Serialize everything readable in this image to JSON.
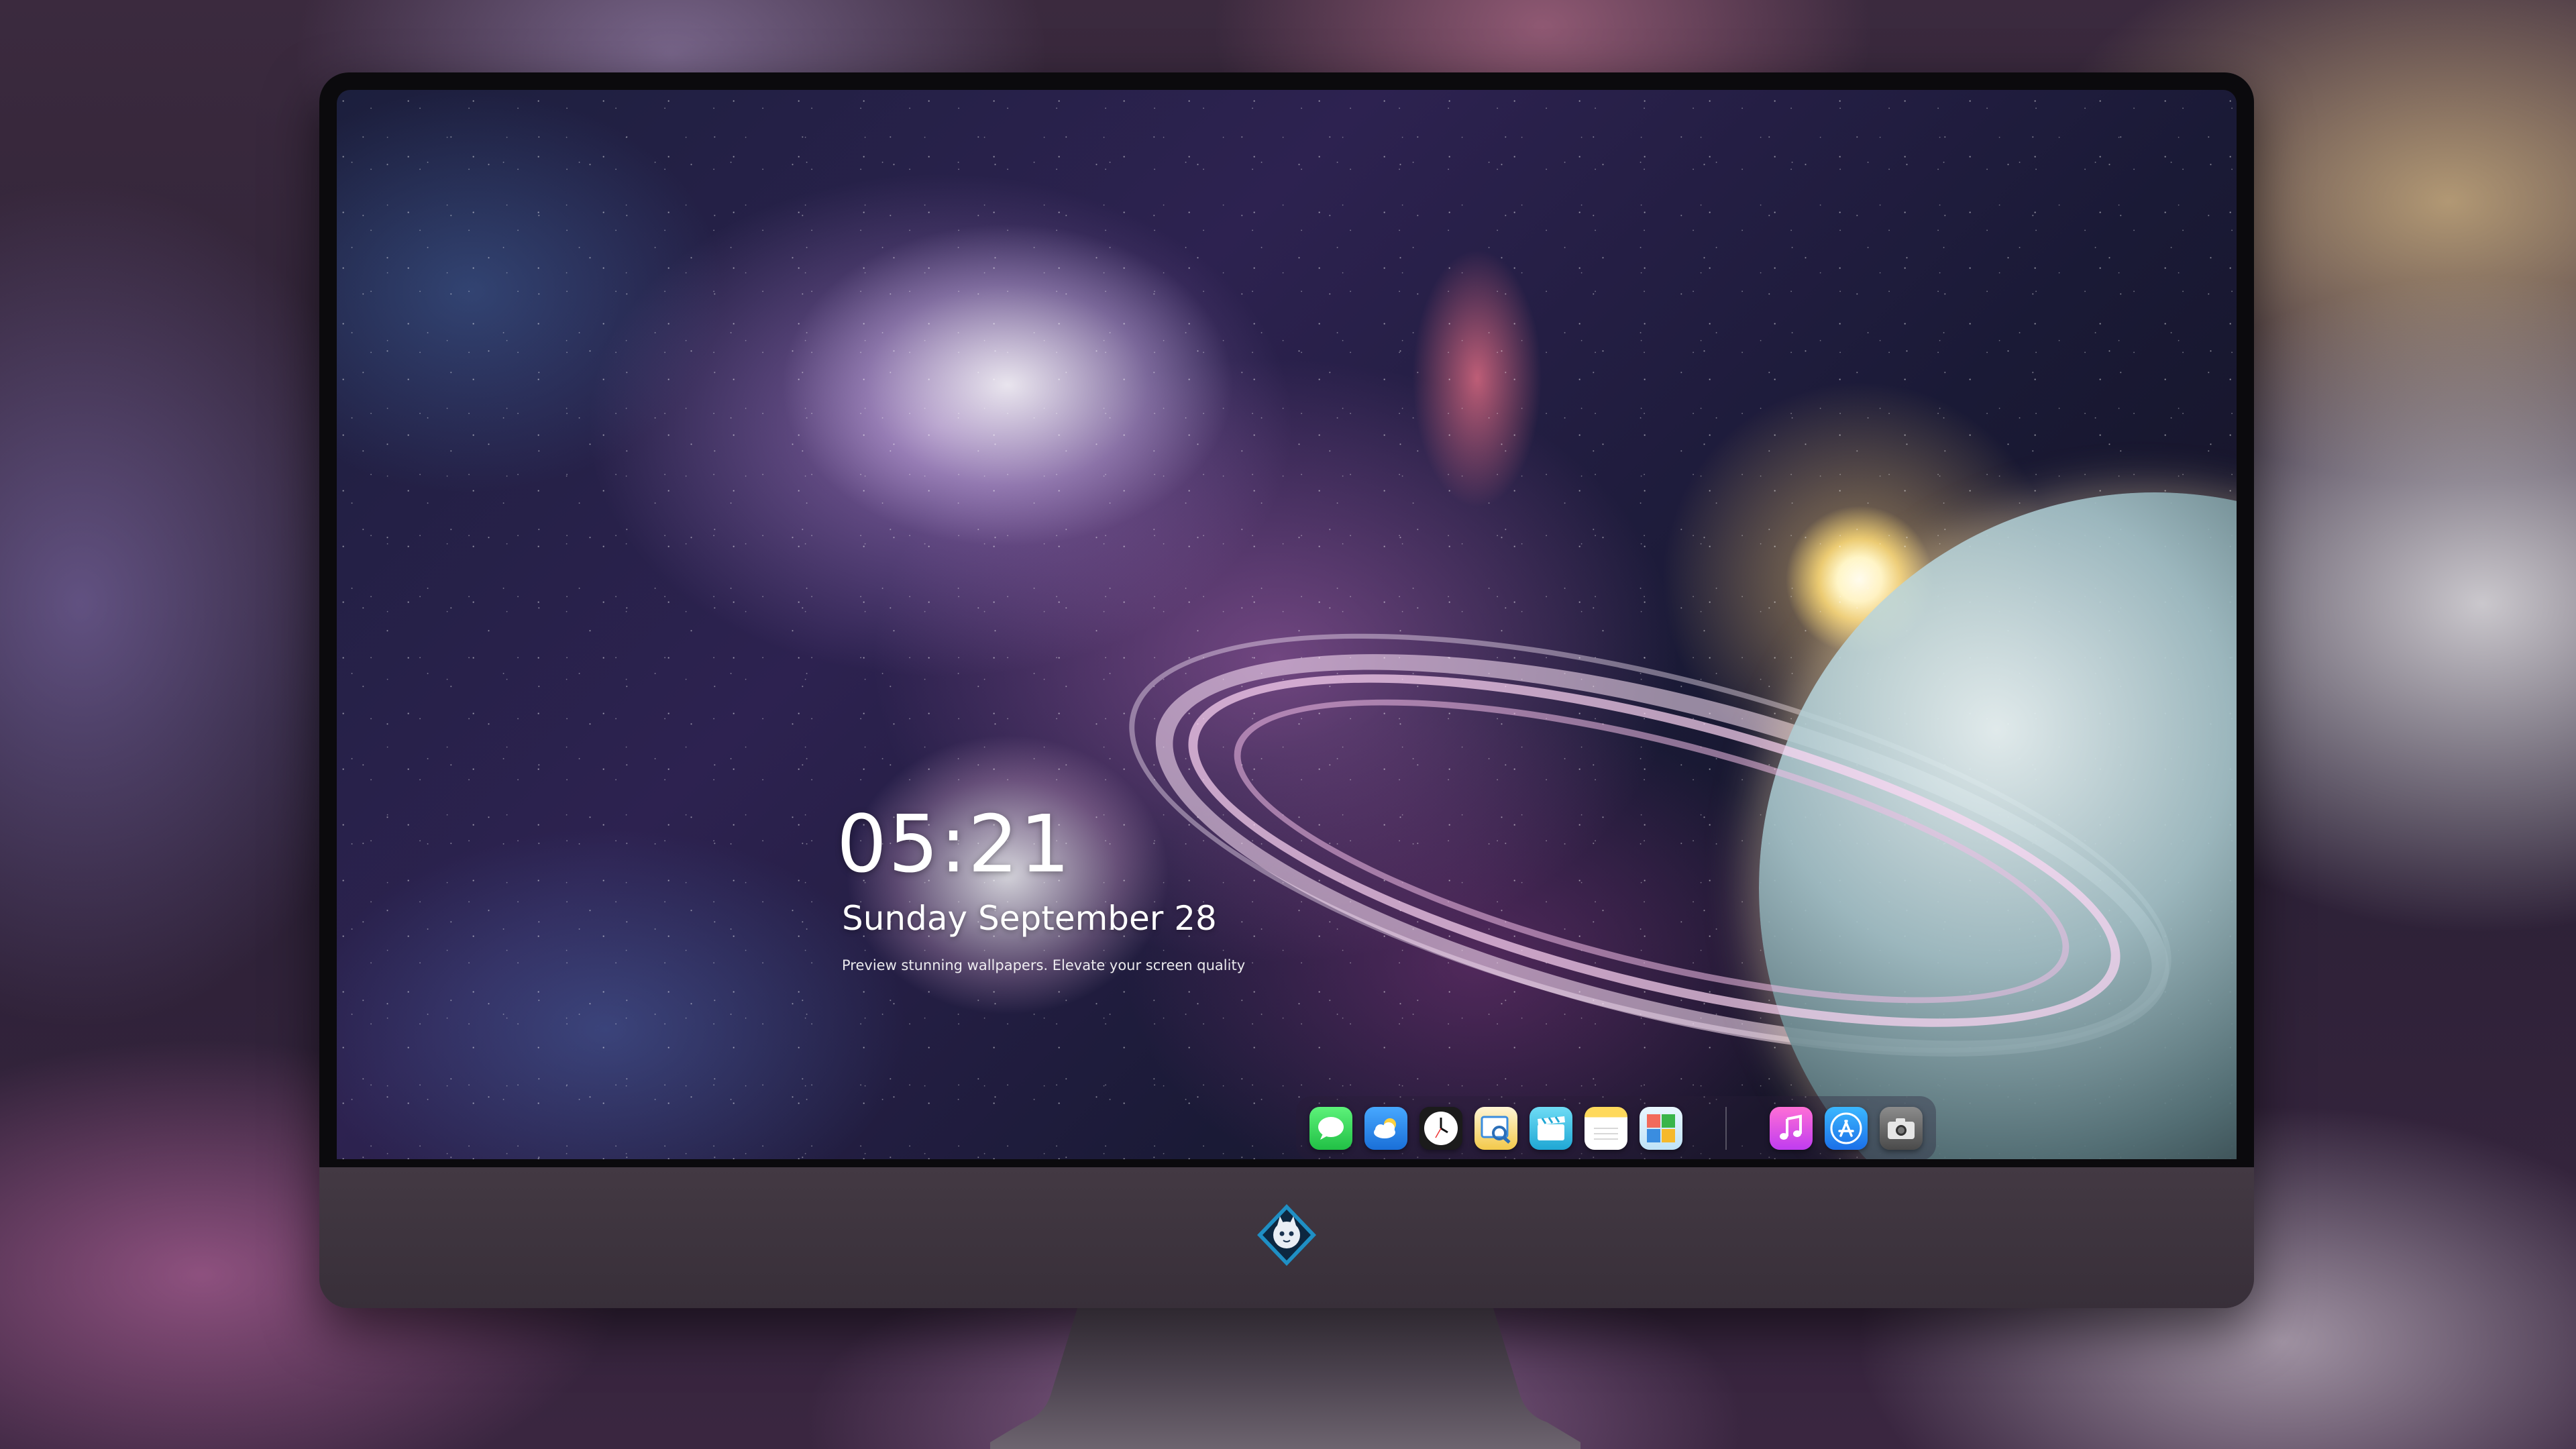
{
  "lockscreen": {
    "time": "05:21",
    "date": "Sunday September  28",
    "tagline": "Preview stunning wallpapers. Elevate your screen quality"
  },
  "dock": {
    "items": [
      {
        "name": "messages",
        "icon": "chat-bubble-icon",
        "color": "#2fd158"
      },
      {
        "name": "weather",
        "icon": "cloud-sun-icon",
        "color": "#2f8cf0"
      },
      {
        "name": "clock",
        "icon": "clock-icon",
        "color": "#f2f2f2"
      },
      {
        "name": "preview",
        "icon": "photo-viewer-icon",
        "color": "#f3c94a"
      },
      {
        "name": "clips",
        "icon": "clapperboard-icon",
        "color": "#36c3e8"
      },
      {
        "name": "notes",
        "icon": "notes-icon",
        "color": "#fdd85a"
      },
      {
        "name": "photo-booth",
        "icon": "photo-grid-icon",
        "color": "#5cc8f4"
      },
      {
        "name": "music",
        "icon": "music-note-icon",
        "color": "#f05adf"
      },
      {
        "name": "app-store",
        "icon": "app-store-icon",
        "color": "#2a8cf3"
      },
      {
        "name": "camera",
        "icon": "camera-icon",
        "color": "#707070"
      }
    ]
  },
  "monitor": {
    "logo_icon": "brand-badge-icon"
  }
}
